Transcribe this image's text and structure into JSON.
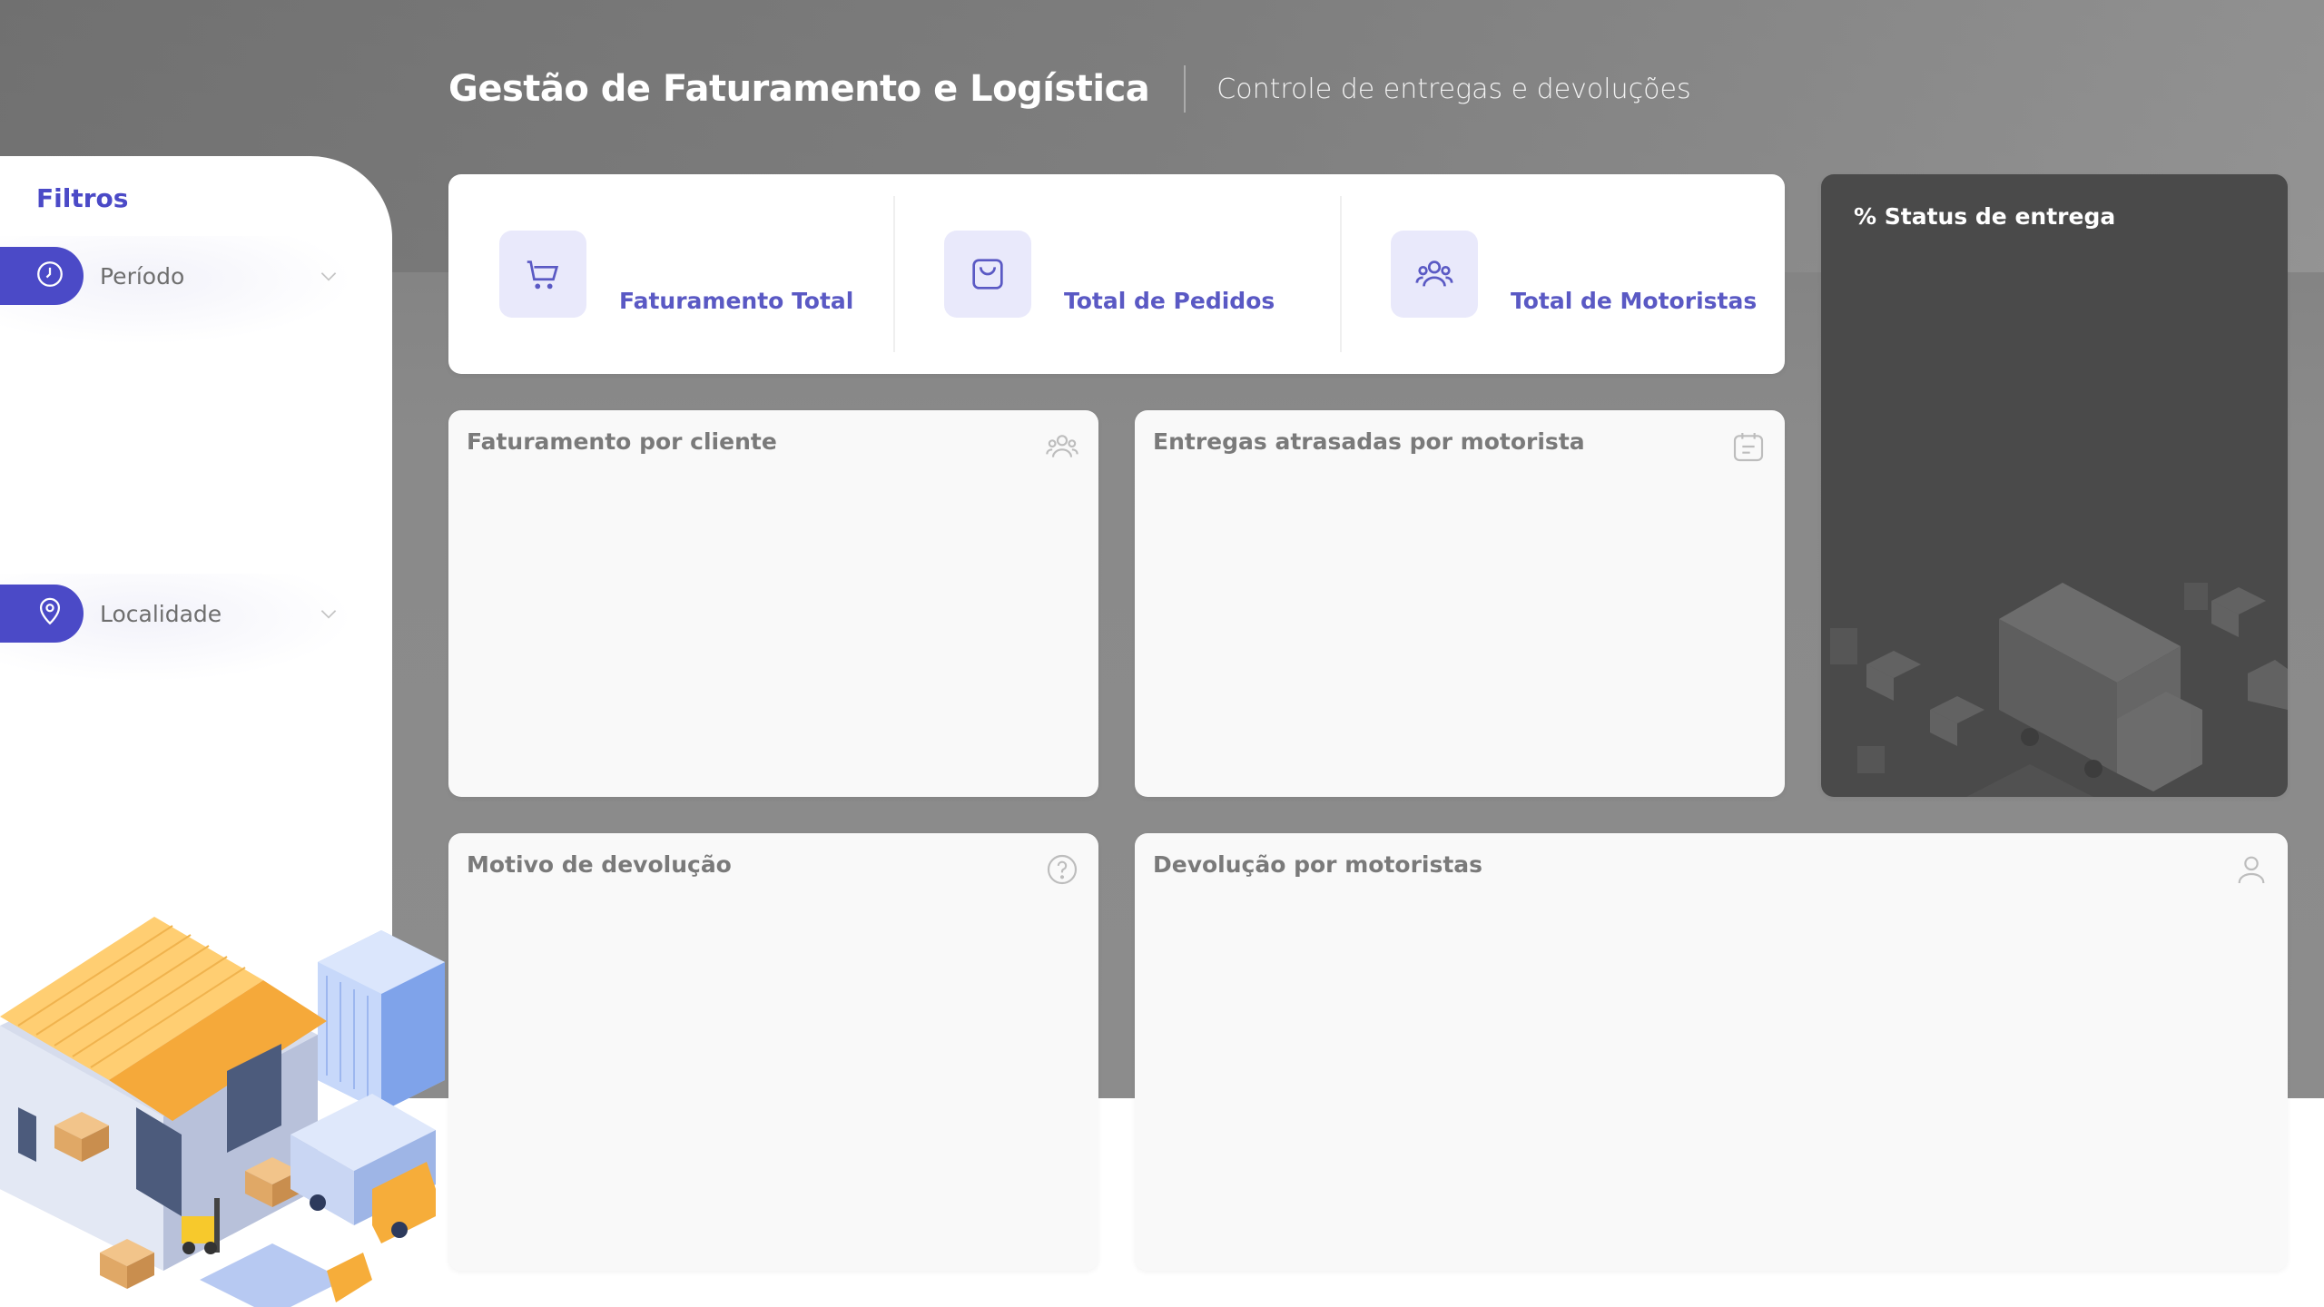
{
  "header": {
    "title": "Gestão de Faturamento e Logística",
    "subtitle": "Controle de entregas e devoluções"
  },
  "sidebar": {
    "title": "Filtros",
    "filters": [
      {
        "label": "Período",
        "icon": "clock-icon"
      },
      {
        "label": "Localidade",
        "icon": "location-pin-icon"
      }
    ]
  },
  "kpis": [
    {
      "label": "Faturamento Total",
      "icon": "cart-icon"
    },
    {
      "label": "Total de Pedidos",
      "icon": "shopping-bag-icon"
    },
    {
      "label": "Total de Motoristas",
      "icon": "users-icon"
    }
  ],
  "status_card": {
    "title": "% Status de entrega"
  },
  "panels": {
    "faturamento_cliente": {
      "title": "Faturamento por cliente",
      "icon": "users-icon"
    },
    "entregas_atrasadas": {
      "title": "Entregas atrasadas por motorista",
      "icon": "calendar-note-icon"
    },
    "motivo_devolucao": {
      "title": "Motivo de devolução",
      "icon": "question-icon"
    },
    "devolucao_motoristas": {
      "title": "Devolução por motoristas",
      "icon": "user-icon"
    }
  },
  "colors": {
    "accent": "#4b4ac7",
    "kpi_text": "#5a59c4",
    "kpi_icon_bg": "#e9e9fb",
    "status_bg": "#4a4a4a"
  }
}
